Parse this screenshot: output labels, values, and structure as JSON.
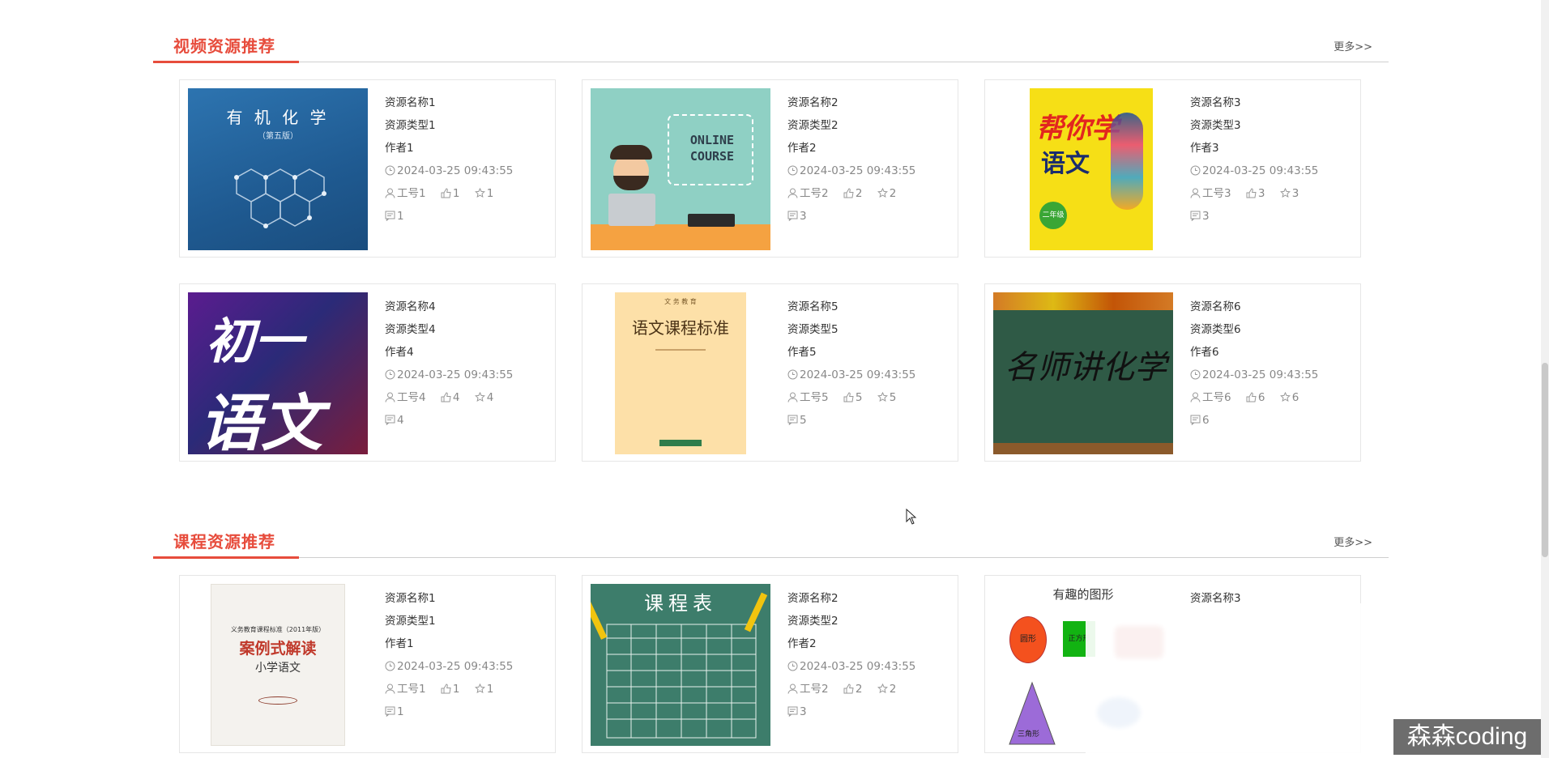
{
  "sections": [
    {
      "title": "视频资源推荐",
      "more": "更多>>",
      "cards": [
        {
          "name": "资源名称1",
          "type": "资源类型1",
          "author": "作者1",
          "time": "2024-03-25 09:43:55",
          "user": "工号1",
          "likes": "1",
          "stars": "1",
          "comments": "1",
          "thumb_text_1": "有 机 化 学",
          "thumb_text_2": "（第五版）"
        },
        {
          "name": "资源名称2",
          "type": "资源类型2",
          "author": "作者2",
          "time": "2024-03-25 09:43:55",
          "user": "工号2",
          "likes": "2",
          "stars": "2",
          "comments": "3",
          "thumb_text_1": "ONLINE",
          "thumb_text_2": "COURSE"
        },
        {
          "name": "资源名称3",
          "type": "资源类型3",
          "author": "作者3",
          "time": "2024-03-25 09:43:55",
          "user": "工号3",
          "likes": "3",
          "stars": "3",
          "comments": "3",
          "thumb_text_1": "帮你学",
          "thumb_text_2": "语文",
          "thumb_text_3": "二年级"
        },
        {
          "name": "资源名称4",
          "type": "资源类型4",
          "author": "作者4",
          "time": "2024-03-25 09:43:55",
          "user": "工号4",
          "likes": "4",
          "stars": "4",
          "comments": "4",
          "thumb_text_1": "初一",
          "thumb_text_2": "语文"
        },
        {
          "name": "资源名称5",
          "type": "资源类型5",
          "author": "作者5",
          "time": "2024-03-25 09:43:55",
          "user": "工号5",
          "likes": "5",
          "stars": "5",
          "comments": "5",
          "thumb_text_1": "语文课程标准",
          "thumb_text_2": "文 务 教 育"
        },
        {
          "name": "资源名称6",
          "type": "资源类型6",
          "author": "作者6",
          "time": "2024-03-25 09:43:55",
          "user": "工号6",
          "likes": "6",
          "stars": "6",
          "comments": "6",
          "thumb_text_1": "名师讲化学"
        }
      ]
    },
    {
      "title": "课程资源推荐",
      "more": "更多>>",
      "cards": [
        {
          "name": "资源名称1",
          "type": "资源类型1",
          "author": "作者1",
          "time": "2024-03-25 09:43:55",
          "user": "工号1",
          "likes": "1",
          "stars": "1",
          "comments": "1",
          "thumb_text_1": "案例式解读",
          "thumb_text_2": "小学语文",
          "thumb_text_3": "义务教育课程标准（2011年版）"
        },
        {
          "name": "资源名称2",
          "type": "资源类型2",
          "author": "作者2",
          "time": "2024-03-25 09:43:55",
          "user": "工号2",
          "likes": "2",
          "stars": "2",
          "comments": "3",
          "thumb_text_1": "课程表"
        },
        {
          "name": "资源名称3",
          "thumb_text_1": "有趣的图形",
          "shape_1": "圆形",
          "shape_2": "正方形",
          "shape_3": "三角形"
        }
      ]
    }
  ],
  "watermark": "森森coding",
  "colors": {
    "accent": "#e74c3c"
  }
}
